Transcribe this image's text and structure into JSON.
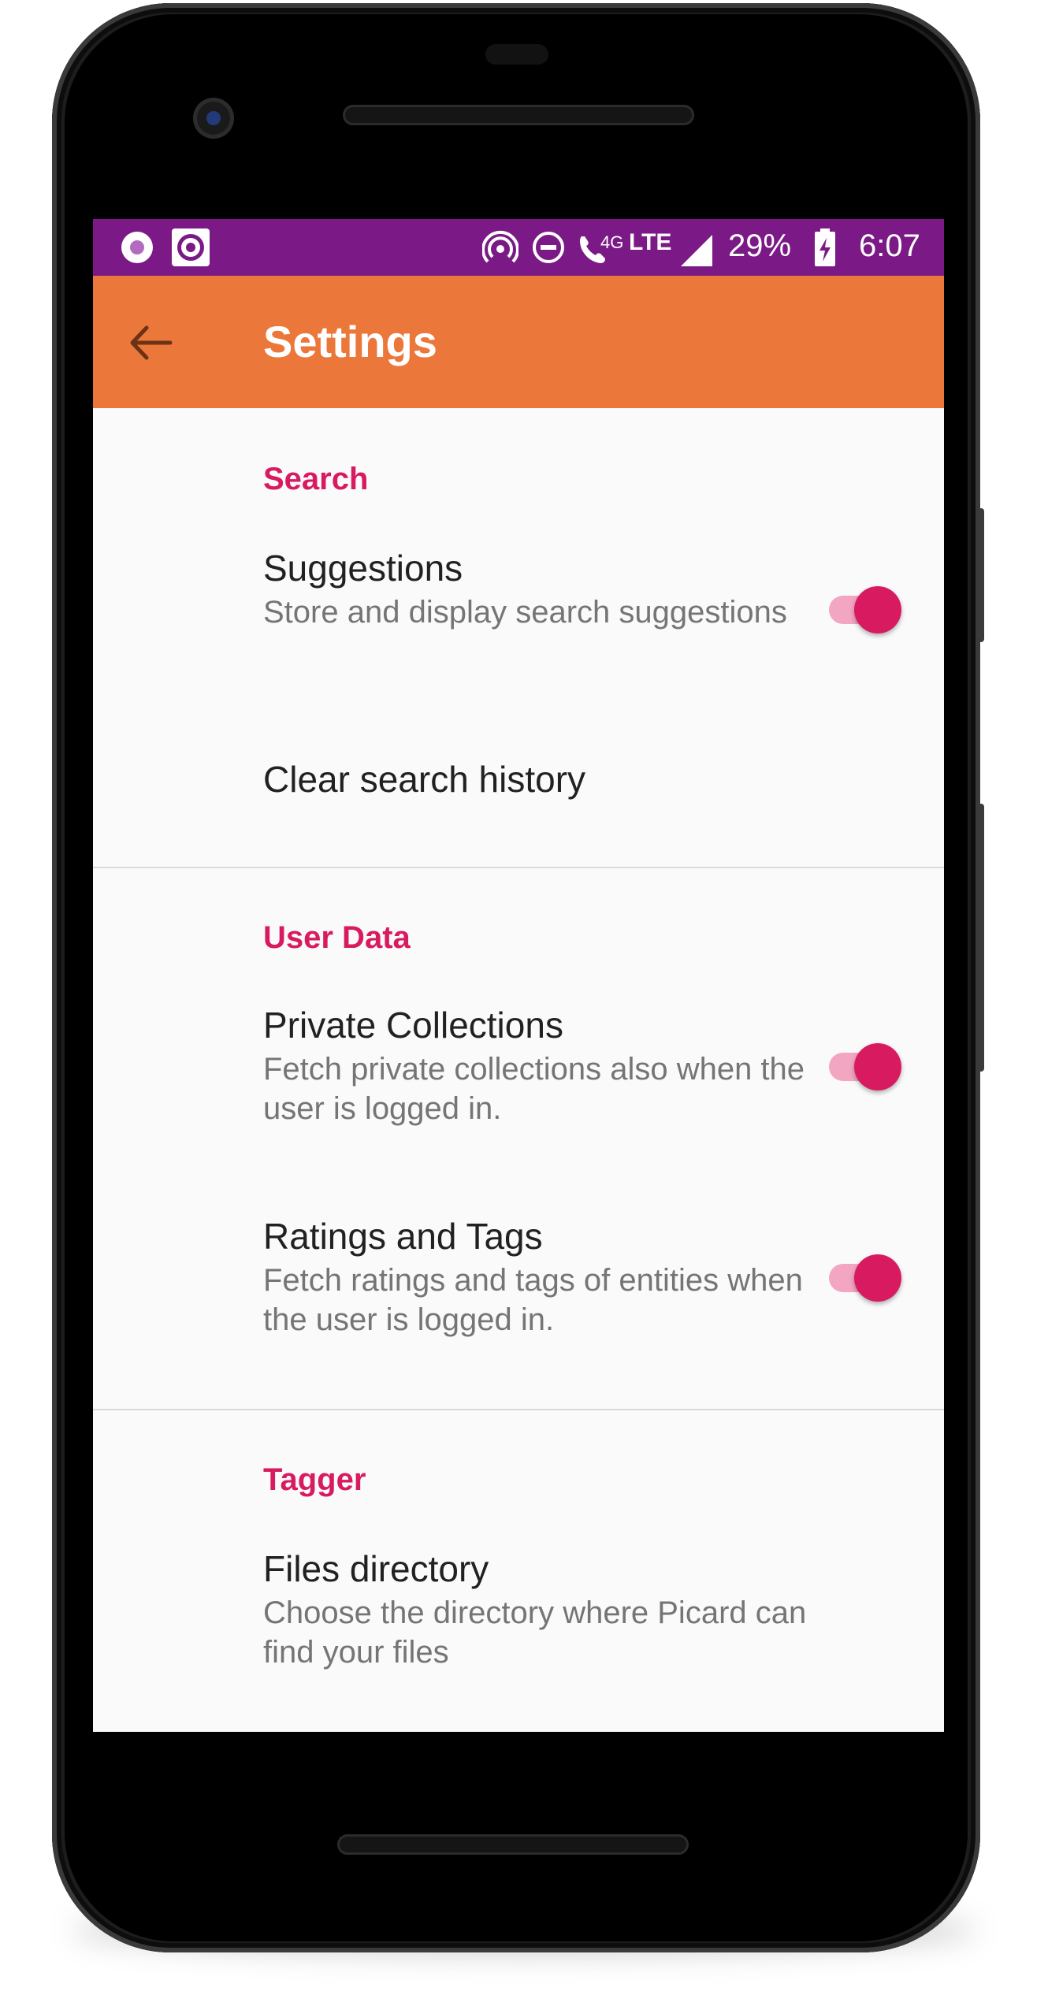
{
  "status_bar": {
    "network_type": "4G",
    "network_label": "LTE",
    "battery": "29%",
    "time": "6:07"
  },
  "toolbar": {
    "title": "Settings"
  },
  "sections": [
    {
      "category": "Search",
      "items": [
        {
          "title": "Suggestions",
          "summary": "Store and display search suggestions",
          "toggle": true
        },
        {
          "title": "Clear search history",
          "summary": ""
        }
      ]
    },
    {
      "category": "User Data",
      "items": [
        {
          "title": "Private Collections",
          "summary": "Fetch private collections also when the user is logged in.",
          "toggle": true
        },
        {
          "title": "Ratings and Tags",
          "summary": "Fetch ratings and tags of entities when the user is logged in.",
          "toggle": true
        }
      ]
    },
    {
      "category": "Tagger",
      "items": [
        {
          "title": "Files directory",
          "summary": "Choose the directory where Picard can find your files"
        }
      ]
    }
  ],
  "colors": {
    "status_bar": "#7b1a86",
    "toolbar": "#ec773b",
    "accent": "#d81b60",
    "background": "#fafafa"
  },
  "icons": [
    "record-icon",
    "target-icon",
    "hotspot-icon",
    "dnd-icon",
    "wifi-calling-icon",
    "signal-icon",
    "battery-charging-icon",
    "back-arrow-icon"
  ]
}
